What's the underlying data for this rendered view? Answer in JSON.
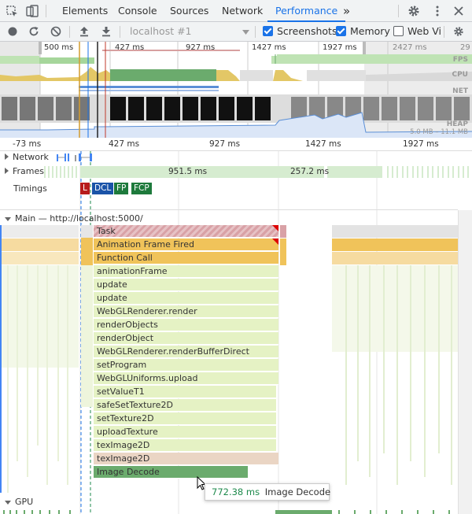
{
  "tabs": {
    "elements": "Elements",
    "console": "Console",
    "sources": "Sources",
    "network": "Network",
    "performance": "Performance",
    "more": "»"
  },
  "toolbar": {
    "profile_select": "localhost #1",
    "screenshots": {
      "label": "Screenshots",
      "checked": true
    },
    "memory": {
      "label": "Memory",
      "checked": true
    },
    "webvitals": {
      "label": "Web Vi",
      "checked": false
    }
  },
  "overview": {
    "ticks": [
      "500 ms",
      "427 ms",
      "927 ms",
      "1427 ms",
      "1927 ms",
      "2427 ms",
      "29"
    ],
    "fps_label": "FPS",
    "cpu_label": "CPU",
    "net_label": "NET",
    "heap_label": "HEAP",
    "heap_range": "5.0 MB – 11.1 MB"
  },
  "ruler": {
    "ticks": [
      "-73 ms",
      "427 ms",
      "927 ms",
      "1427 ms",
      "1927 ms"
    ]
  },
  "tracks": {
    "network": "Network",
    "frames": "Frames",
    "frame1": "951.5 ms",
    "frame2": "257.2 ms",
    "timings": "Timings",
    "main": "Main — http://localhost:5000/",
    "gpu": "GPU"
  },
  "timings": {
    "l": "L",
    "dcl": "DCL",
    "fp": "FP",
    "fcp": "FCP"
  },
  "flame": [
    {
      "label": "Task",
      "color": "#d9a1a6"
    },
    {
      "label": "Animation Frame Fired",
      "color": "#f0c35a"
    },
    {
      "label": "Function Call",
      "color": "#f0c35a"
    },
    {
      "label": "animationFrame",
      "color": "#e5f2c4"
    },
    {
      "label": "update",
      "color": "#e5f2c4"
    },
    {
      "label": "update",
      "color": "#e5f2c4"
    },
    {
      "label": "WebGLRenderer.render",
      "color": "#e5f2c4"
    },
    {
      "label": "renderObjects",
      "color": "#e5f2c4"
    },
    {
      "label": "renderObject",
      "color": "#e5f2c4"
    },
    {
      "label": "WebGLRenderer.renderBufferDirect",
      "color": "#e5f2c4"
    },
    {
      "label": "setProgram",
      "color": "#e5f2c4"
    },
    {
      "label": "WebGLUniforms.upload",
      "color": "#e5f2c4"
    },
    {
      "label": "setValueT1",
      "color": "#e5f2c4"
    },
    {
      "label": "safeSetTexture2D",
      "color": "#e5f2c4"
    },
    {
      "label": "setTexture2D",
      "color": "#e5f2c4"
    },
    {
      "label": "uploadTexture",
      "color": "#e5f2c4"
    },
    {
      "label": "texImage2D",
      "color": "#e5f2c4"
    },
    {
      "label": "texImage2D",
      "color": "#ead5c4"
    },
    {
      "label": "Image Decode",
      "color": "#6bab6d"
    }
  ],
  "tooltip": {
    "duration": "772.38 ms",
    "name": "Image Decode"
  }
}
